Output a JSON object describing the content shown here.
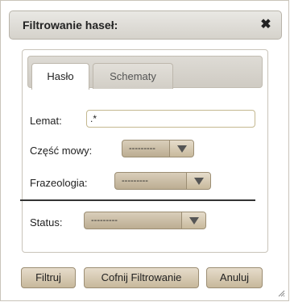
{
  "dialog": {
    "title": "Filtrowanie haseł:",
    "close_glyph": "✖"
  },
  "tabs": [
    {
      "label": "Hasło",
      "active": true
    },
    {
      "label": "Schematy",
      "active": false
    }
  ],
  "form": {
    "lemat_label": "Lemat:",
    "lemat_value": ".*",
    "czesc_mowy_label": "Część mowy:",
    "czesc_mowy_value": "---------",
    "frazeologia_label": "Frazeologia:",
    "frazeologia_value": "---------",
    "status_label": "Status:",
    "status_value": "---------"
  },
  "buttons": {
    "filter": "Filtruj",
    "reset": "Cofnij Filtrowanie",
    "cancel": "Anuluj"
  },
  "icons": {
    "close": "close-icon",
    "dropdown": "chevron-down-icon",
    "resize": "resize-grip-icon"
  }
}
